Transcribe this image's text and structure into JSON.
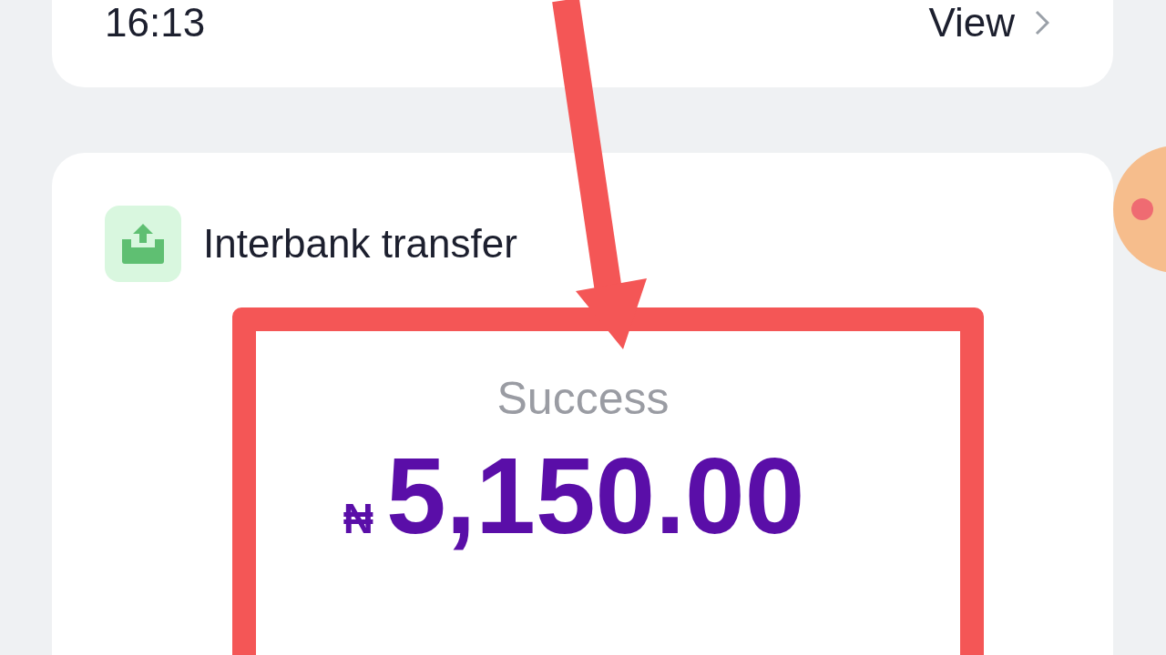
{
  "top_card": {
    "time": "16:13",
    "view_label": "View"
  },
  "transaction": {
    "type": "Interbank transfer",
    "status": "Success",
    "currency": "₦",
    "amount": "5,150.00"
  }
}
